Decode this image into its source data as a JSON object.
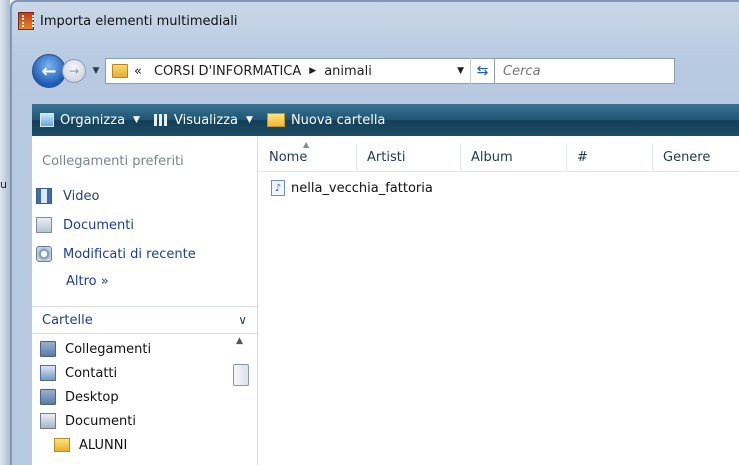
{
  "window": {
    "title": "Importa elementi multimediali"
  },
  "left_strip": {
    "text": "u"
  },
  "address": {
    "overflow": "«",
    "path": [
      "CORSI D'INFORMATICA",
      "animali"
    ]
  },
  "search": {
    "placeholder": "Cerca"
  },
  "toolbar": {
    "organize_label": "Organizza",
    "view_label": "Visualizza",
    "new_folder_label": "Nuova cartella"
  },
  "favorites": {
    "title": "Collegamenti preferiti",
    "items": [
      {
        "label": "Video",
        "icon": "video-icon"
      },
      {
        "label": "Documenti",
        "icon": "documents-icon"
      },
      {
        "label": "Modificati di recente",
        "icon": "recent-icon"
      }
    ],
    "more_label": "Altro",
    "more_glyph": "»"
  },
  "folders": {
    "header": "Cartelle",
    "items": [
      {
        "label": "Collegamenti",
        "icon": "folder-icon"
      },
      {
        "label": "Contatti",
        "icon": "contacts-icon"
      },
      {
        "label": "Desktop",
        "icon": "folder-icon"
      },
      {
        "label": "Documenti",
        "icon": "documents-folder-icon"
      },
      {
        "label": "ALUNNI",
        "icon": "yellow-folder-icon"
      }
    ]
  },
  "file_list": {
    "columns": [
      "Nome",
      "Artisti",
      "Album",
      "#",
      "Genere"
    ],
    "files": [
      {
        "name": "nella_vecchia_fattoria",
        "icon": "audio-file-icon"
      }
    ]
  },
  "colors": {
    "toolbar": "#1f5474",
    "link": "#1d3f8f",
    "frame": "#b9cbe2"
  }
}
